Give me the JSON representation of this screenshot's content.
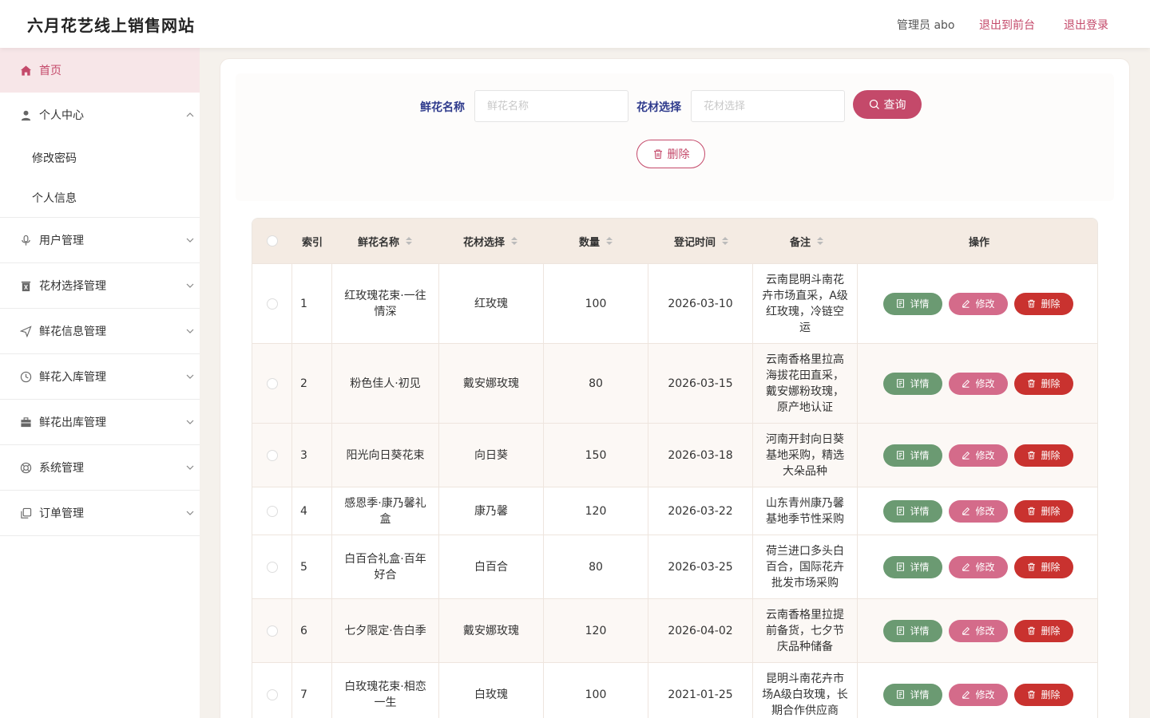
{
  "header": {
    "title": "六月花艺线上销售网站",
    "user": "管理员 abo",
    "front_link": "退出到前台",
    "logout_link": "退出登录"
  },
  "sidebar": {
    "home": "首页",
    "personal_center": "个人中心",
    "sub_items": [
      "修改密码",
      "个人信息"
    ],
    "groups": [
      "用户管理",
      "花材选择管理",
      "鲜花信息管理",
      "鲜花入库管理",
      "鲜花出库管理",
      "系统管理",
      "订单管理"
    ]
  },
  "search": {
    "name_label": "鲜花名称",
    "name_placeholder": "鲜花名称",
    "material_label": "花材选择",
    "material_placeholder": "花材选择",
    "query_button": "查询",
    "delete_button": "删除"
  },
  "table": {
    "headers": [
      "索引",
      "鲜花名称",
      "花材选择",
      "数量",
      "登记时间",
      "备注",
      "操作"
    ],
    "actions": {
      "detail": "详情",
      "edit": "修改",
      "delete": "删除"
    },
    "rows": [
      {
        "index": "1",
        "name": "红玫瑰花束·一往情深",
        "material": "红玫瑰",
        "qty": "100",
        "date": "2026-03-10",
        "note": "云南昆明斗南花卉市场直采，A级红玫瑰，冷链空运"
      },
      {
        "index": "2",
        "name": "粉色佳人·初见",
        "material": "戴安娜玫瑰",
        "qty": "80",
        "date": "2026-03-15",
        "note": "云南香格里拉高海拔花田直采，戴安娜粉玫瑰，原产地认证"
      },
      {
        "index": "3",
        "name": "阳光向日葵花束",
        "material": "向日葵",
        "qty": "150",
        "date": "2026-03-18",
        "note": "河南开封向日葵基地采购，精选大朵品种"
      },
      {
        "index": "4",
        "name": "感恩季·康乃馨礼盒",
        "material": "康乃馨",
        "qty": "120",
        "date": "2026-03-22",
        "note": "山东青州康乃馨基地季节性采购"
      },
      {
        "index": "5",
        "name": "白百合礼盒·百年好合",
        "material": "白百合",
        "qty": "80",
        "date": "2026-03-25",
        "note": "荷兰进口多头白百合，国际花卉批发市场采购"
      },
      {
        "index": "6",
        "name": "七夕限定·告白季",
        "material": "戴安娜玫瑰",
        "qty": "120",
        "date": "2026-04-02",
        "note": "云南香格里拉提前备货，七夕节庆品种储备"
      },
      {
        "index": "7",
        "name": "白玫瑰花束·相恋一生",
        "material": "白玫瑰",
        "qty": "100",
        "date": "2021-01-25",
        "note": "昆明斗南花卉市场A级白玫瑰，长期合作供应商"
      }
    ]
  },
  "colors": {
    "accent": "#c4496a",
    "header_label": "#2e3a8c",
    "detail_btn": "#6b9a72",
    "edit_btn": "#d46b8a",
    "delete_btn": "#c9322f",
    "table_head": "#f4ebe3"
  }
}
